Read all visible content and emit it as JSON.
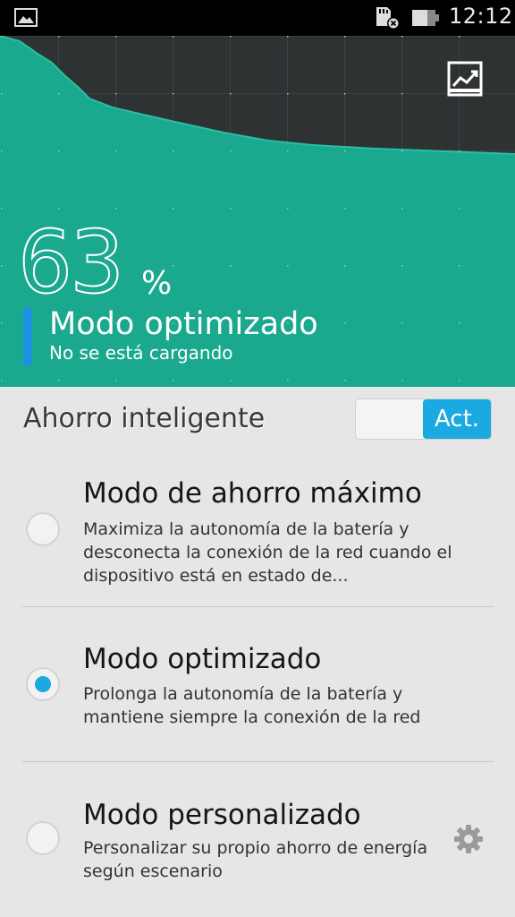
{
  "status_bar": {
    "time": "12:12",
    "icons": [
      "gallery-notification-icon",
      "sd-card-error-icon",
      "battery-icon"
    ]
  },
  "battery": {
    "level_percent": 63,
    "percent_number": "63",
    "percent_sign": "%",
    "mode_title": "Modo optimizado",
    "charging_status": "No se está cargando",
    "stats_icon": "stats-chart-icon"
  },
  "smart_saving": {
    "label": "Ahorro inteligente",
    "toggle_on_label": "Act.",
    "toggle_state": "on"
  },
  "options": [
    {
      "title": "Modo de ahorro máximo",
      "description": "Maximiza la autonomía de la batería y desconecta la conexión de la red cuando el dispositivo está en estado de...",
      "selected": false
    },
    {
      "title": "Modo optimizado",
      "description": "Prolonga la autonomía de la batería y mantiene siempre la conexión de la red",
      "selected": true
    },
    {
      "title": "Modo personalizado",
      "description": "Personalizar su propio ahorro de energía según escenario",
      "selected": false,
      "settings_icon": "gear-icon"
    }
  ],
  "colors": {
    "accent": "#1aa9e0",
    "graph_fill": "#1aa88f",
    "graph_bg": "#2f3233",
    "mode_indicator": "#1e90e0"
  }
}
